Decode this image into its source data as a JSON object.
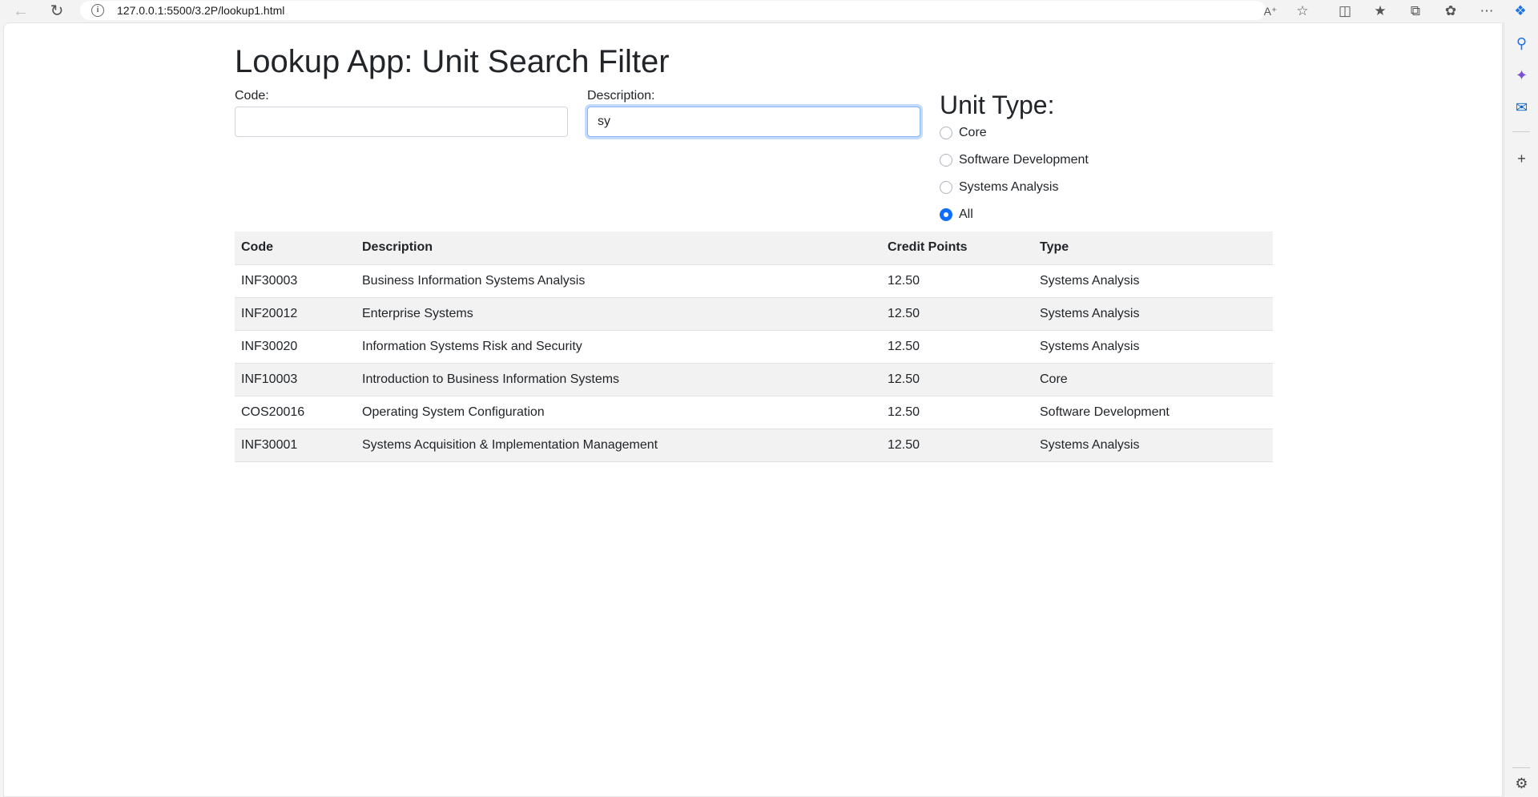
{
  "browser": {
    "url": "127.0.0.1:5500/3.2P/lookup1.html"
  },
  "page": {
    "title": "Lookup App: Unit Search Filter",
    "code_label": "Code:",
    "code_value": "",
    "description_label": "Description:",
    "description_value": "sy",
    "unit_type_heading": "Unit Type:",
    "unit_types": [
      {
        "label": "Core",
        "checked": false
      },
      {
        "label": "Software Development",
        "checked": false
      },
      {
        "label": "Systems Analysis",
        "checked": false
      },
      {
        "label": "All",
        "checked": true
      }
    ]
  },
  "table": {
    "headers": [
      "Code",
      "Description",
      "Credit Points",
      "Type"
    ],
    "rows": [
      [
        "INF30003",
        "Business Information Systems Analysis",
        "12.50",
        "Systems Analysis"
      ],
      [
        "INF20012",
        "Enterprise Systems",
        "12.50",
        "Systems Analysis"
      ],
      [
        "INF30020",
        "Information Systems Risk and Security",
        "12.50",
        "Systems Analysis"
      ],
      [
        "INF10003",
        "Introduction to Business Information Systems",
        "12.50",
        "Core"
      ],
      [
        "COS20016",
        "Operating System Configuration",
        "12.50",
        "Software Development"
      ],
      [
        "INF30001",
        "Systems Acquisition & Implementation Management",
        "12.50",
        "Systems Analysis"
      ]
    ]
  },
  "colors": {
    "accent": "#0d6efd",
    "stripe": "#f2f2f2"
  }
}
